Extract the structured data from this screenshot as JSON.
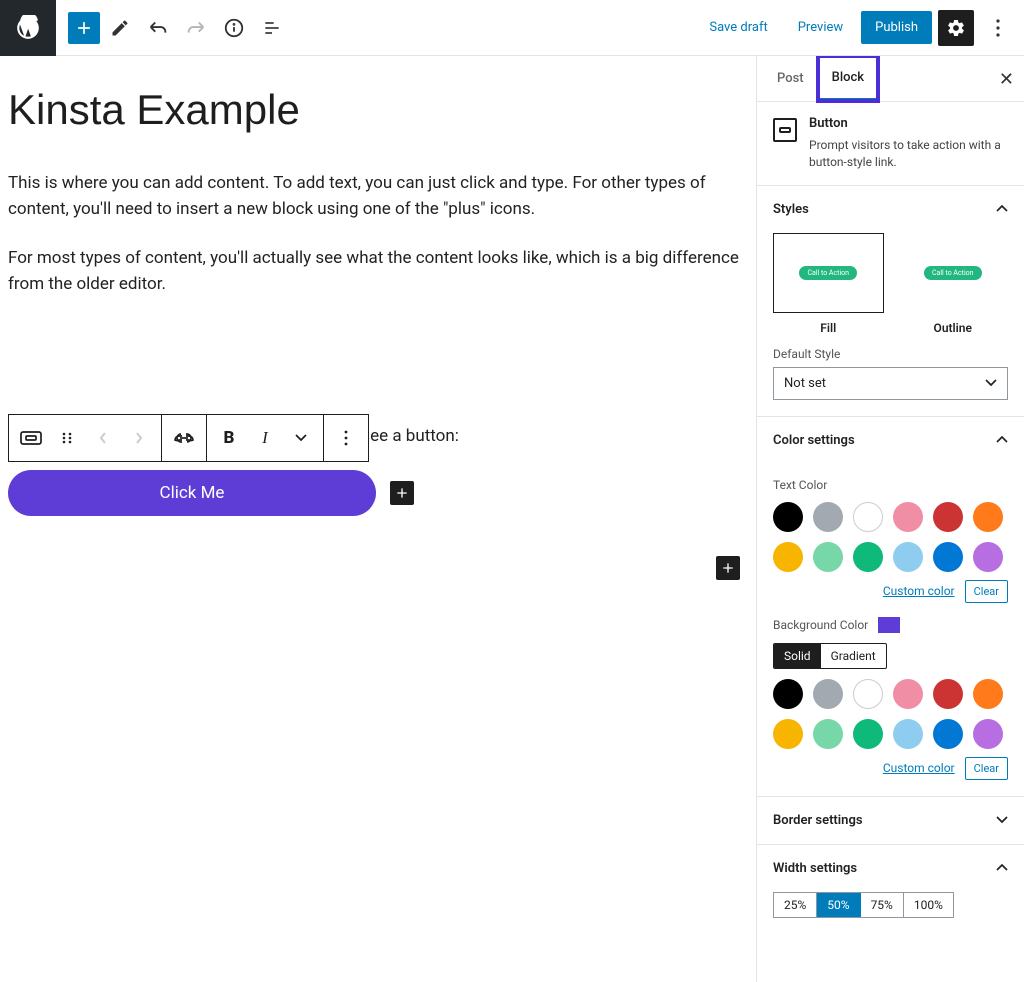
{
  "topbar": {
    "save_draft": "Save draft",
    "preview": "Preview",
    "publish": "Publish"
  },
  "editor": {
    "title": "Kinsta Example",
    "para1": "This is where you can add content. To add text, you can just click and type. For other types of content, you'll need to insert a new block using one of the \"plus\" icons.",
    "para2": "For most types of content, you'll actually see what the content looks like, which is a big difference from the older editor.",
    "para3": "For example, here's a button and you'll actually see a button:",
    "button_label": "Click Me"
  },
  "sidebar": {
    "tabs": {
      "post": "Post",
      "block": "Block"
    },
    "block_header": {
      "title": "Button",
      "desc": "Prompt visitors to take action with a button-style link."
    },
    "styles": {
      "heading": "Styles",
      "fill": "Fill",
      "outline": "Outline",
      "default_label": "Default Style",
      "default_value": "Not set"
    },
    "color": {
      "heading": "Color settings",
      "text_label": "Text Color",
      "bg_label": "Background Color",
      "custom": "Custom color",
      "clear": "Clear",
      "solid": "Solid",
      "gradient": "Gradient",
      "bg_selected": "#5e3cd6",
      "palette": [
        "#000000",
        "#a2a9b1",
        "#ffffff",
        "#f08ea6",
        "#cc3333",
        "#ff7a1a",
        "#f7b500",
        "#77d7a8",
        "#0fb97a",
        "#8ecdf0",
        "#0078d4",
        "#b76ee0"
      ]
    },
    "border": {
      "heading": "Border settings"
    },
    "width": {
      "heading": "Width settings",
      "options": [
        "25%",
        "50%",
        "75%",
        "100%"
      ],
      "selected": "50%"
    }
  }
}
